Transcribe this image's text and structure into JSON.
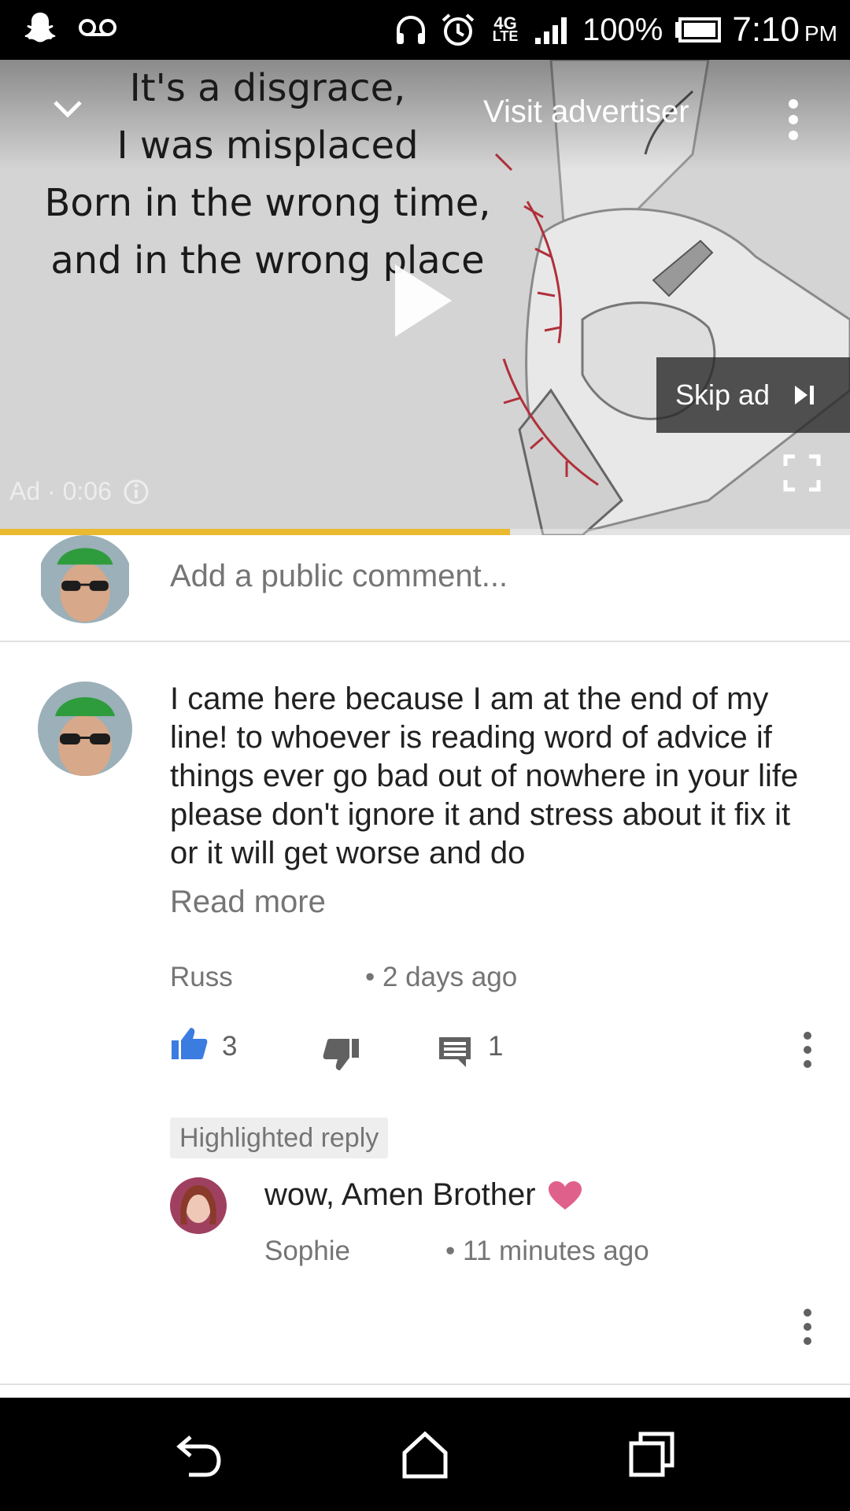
{
  "status_bar": {
    "time": "7:10",
    "ampm": "PM",
    "battery_percent": "100%",
    "network_type": "4G",
    "network_sub": "LTE",
    "icons": [
      "snapchat-icon",
      "voicemail-icon",
      "headphones-icon",
      "alarm-icon",
      "lte-icon",
      "signal-icon",
      "battery-icon"
    ]
  },
  "video": {
    "ad_quote_lines": [
      "It's a disgrace,",
      "I was misplaced",
      "Born in the wrong time,",
      "and in the wrong place"
    ],
    "visit_advertiser": "Visit advertiser",
    "skip_ad": "Skip ad",
    "ad_label": "Ad · 0:06",
    "progress_fraction": 0.6,
    "progress_color": "#e9b92f"
  },
  "add_comment": {
    "placeholder": "Add a public comment..."
  },
  "comment": {
    "text": "I came here because I am at the end of my line! to whoever is reading word of advice if things ever go bad out of nowhere in your life please don't ignore it and stress about it fix it or it will get worse and do",
    "read_more": "Read more",
    "author": "Russ",
    "time": "• 2 days ago",
    "likes": "3",
    "replies": "1",
    "like_color": "#3b7ce0"
  },
  "reply": {
    "badge": "Highlighted reply",
    "text": "wow, Amen Brother",
    "heart_color": "#e0608c",
    "author": "Sophie",
    "time": "• 11 minutes ago"
  }
}
